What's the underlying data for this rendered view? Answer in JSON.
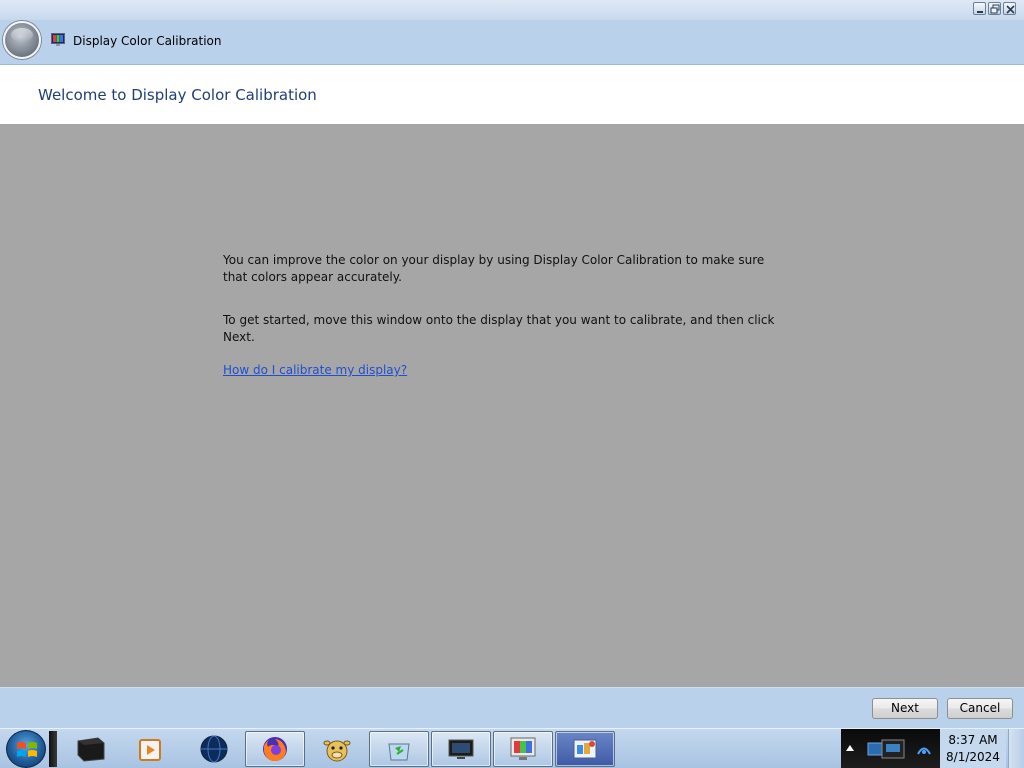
{
  "window": {
    "title": "Display Color Calibration",
    "page_title": "Welcome to Display Color Calibration"
  },
  "content": {
    "paragraph_1": "You can improve the color on your display by using Display Color Calibration to make sure that colors appear accurately.",
    "paragraph_2": "To get started, move this window onto the display that you want to calibrate, and then click Next.",
    "help_link": "How do I calibrate my display?"
  },
  "footer": {
    "next_label": "Next",
    "cancel_label": "Cancel"
  },
  "taskbar": {
    "items": [
      {
        "name": "monitor-app-icon"
      },
      {
        "name": "media-player-icon"
      },
      {
        "name": "globe-icon"
      },
      {
        "name": "firefox-icon"
      },
      {
        "name": "cow-app-icon"
      },
      {
        "name": "recycle-bin-icon"
      },
      {
        "name": "remote-desktop-icon"
      },
      {
        "name": "display-color-calibration-icon"
      },
      {
        "name": "control-panel-icon"
      }
    ],
    "clock_time": "8:37 AM",
    "clock_date": "8/1/2024"
  },
  "colors": {
    "title_bar": "#b9d1ea",
    "content_background": "#a6a6a6",
    "link": "#1f4fd1",
    "page_title": "#1e3f7a"
  }
}
